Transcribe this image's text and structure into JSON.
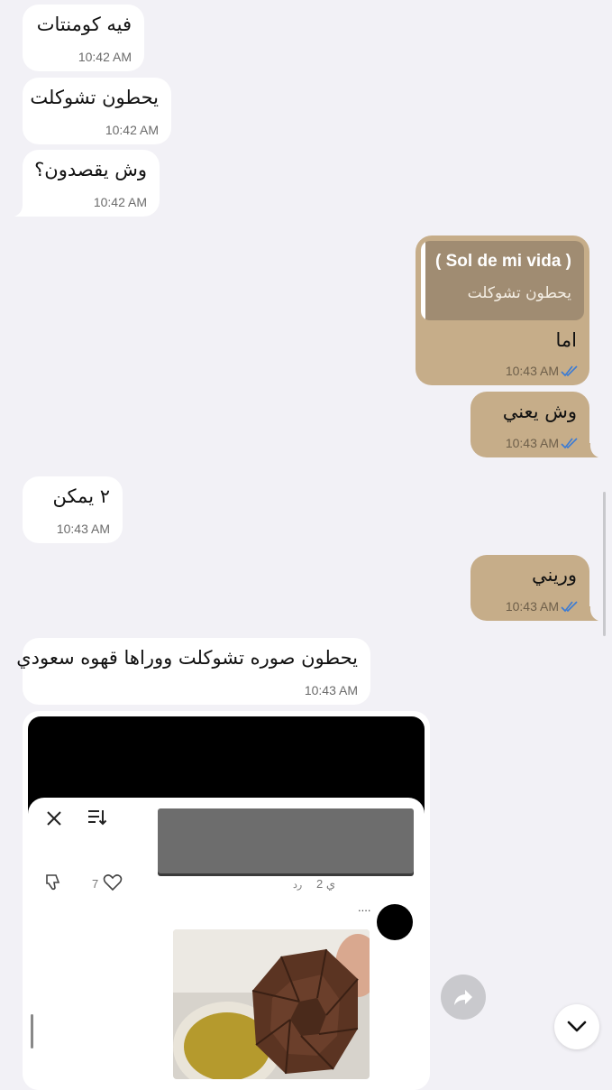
{
  "messages": [
    {
      "text": "فيه كومنتات",
      "time": "10:42 AM"
    },
    {
      "text": "يحطون تشوكلت",
      "time": "10:42 AM"
    },
    {
      "text": "وش يقصدون؟",
      "time": "10:42 AM"
    },
    {
      "text": "اما",
      "time": "10:43 AM",
      "quote_name": "( Sol de mi vida )",
      "quote_text": "يحطون تشوكلت"
    },
    {
      "text": "وش يعني",
      "time": "10:43 AM"
    },
    {
      "text": "٢ يمكن",
      "time": "10:43 AM"
    },
    {
      "text": "وريني",
      "time": "10:43 AM"
    },
    {
      "text": "يحطون صوره تشوكلت ووراها قهوه سعودي",
      "time": "10:43 AM"
    }
  ],
  "media": {
    "likes": "7",
    "reply_label": "رد",
    "age": "2 ي",
    "dots": "...."
  },
  "icons": {
    "close": "close-icon",
    "sort": "sort-icon",
    "dislike": "thumbs-down-icon",
    "like": "heart-icon",
    "forward": "forward-icon",
    "scroll_down": "chevron-down-icon",
    "read": "double-check-icon"
  },
  "colors": {
    "background": "#f2f1f6",
    "incoming": "#ffffff",
    "outgoing": "#c6ad89",
    "quote": "#a08c72",
    "read_ticks": "#3a7bd5"
  }
}
